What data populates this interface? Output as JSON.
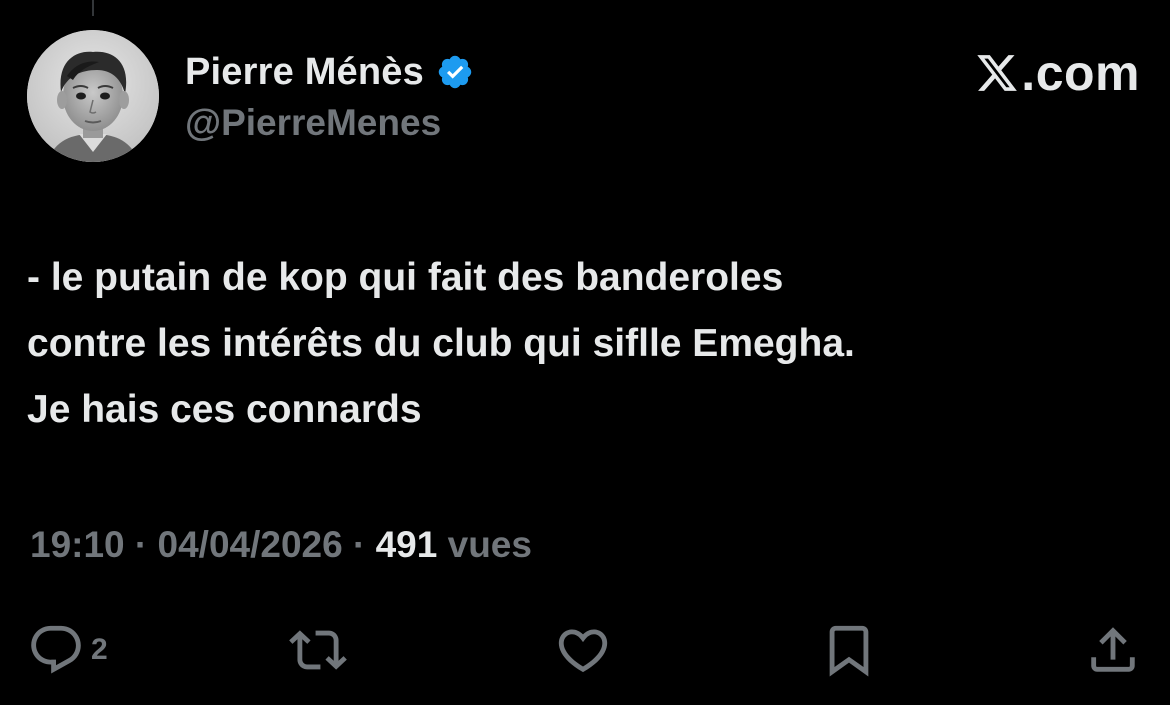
{
  "author": {
    "display_name": "Pierre Ménès",
    "handle": "@PierreMenes",
    "verified": true
  },
  "brand": {
    "label": ".com",
    "logo": "x-logo-icon"
  },
  "tweet": {
    "lines": [
      "- le putain de kop qui fait des banderoles",
      "contre les intérêts du club qui siflle Emegha.",
      "Je hais ces connards"
    ]
  },
  "meta": {
    "time": "19:10",
    "separator": " · ",
    "date": "04/04/2026",
    "views_count": "491",
    "views_label": "vues"
  },
  "actions": {
    "reply_count": "2",
    "icons": [
      "reply-icon",
      "retweet-icon",
      "like-icon",
      "bookmark-icon",
      "share-icon"
    ]
  },
  "colors": {
    "background": "#000000",
    "text_primary": "#e7e9ea",
    "text_secondary": "#71767b",
    "verified_badge": "#1d9bf0"
  }
}
